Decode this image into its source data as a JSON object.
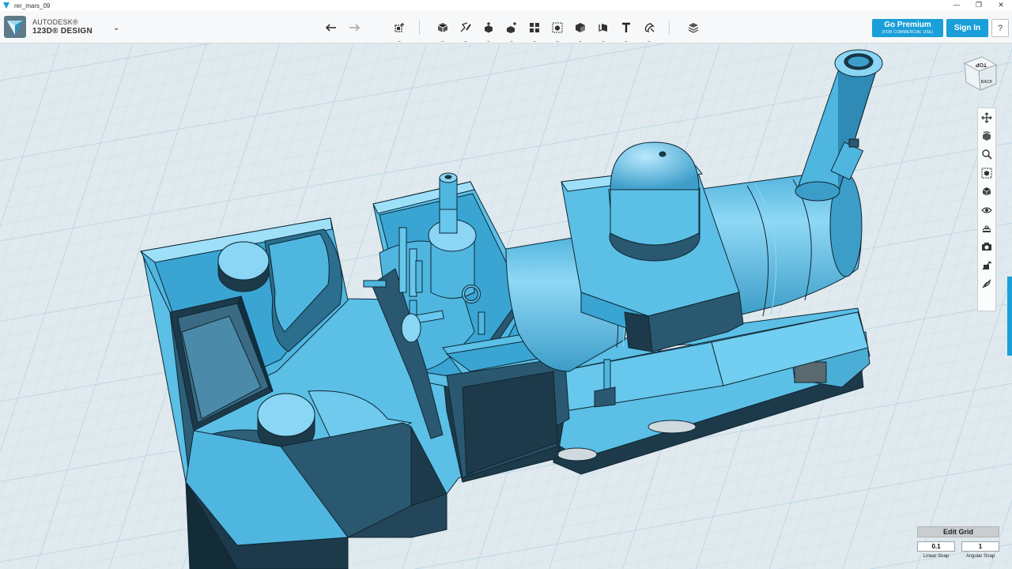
{
  "window": {
    "title": "rer_mars_09",
    "controls": {
      "minimize": "—",
      "maximize": "❐",
      "close": "✕"
    }
  },
  "brand": {
    "line1": "AUTODESK®",
    "line2": "123D® DESIGN",
    "menu_caret": "⌄"
  },
  "toolbar": {
    "groups": [
      {
        "name": "history",
        "items": [
          "undo-icon",
          "redo-icon"
        ]
      },
      {
        "name": "transform",
        "items": [
          "transform-icon"
        ]
      },
      {
        "name": "modeling",
        "items": [
          "primitives-icon",
          "sketch-icon",
          "construct-icon",
          "modify-icon",
          "pattern-icon",
          "grouping-icon",
          "combine-icon",
          "measure-icon",
          "text-icon",
          "snap-icon"
        ]
      },
      {
        "name": "material",
        "items": [
          "material-icon"
        ]
      }
    ],
    "premium_label": "Go Premium",
    "premium_sub": "(FOR COMMERCIAL USE)",
    "signin_label": "Sign In",
    "help_label": "?"
  },
  "viewcube": {
    "top_label": "TOP",
    "back_label": "BACK"
  },
  "navbar": {
    "items": [
      "pan-icon",
      "orbit-icon",
      "zoom-icon",
      "fit-icon",
      "views-icon",
      "visibility-icon",
      "materials-outline-icon",
      "screenshot-icon",
      "hide-sketches-icon",
      "hide-meshes-icon"
    ]
  },
  "editgrid": {
    "button_label": "Edit Grid",
    "linear_snap_value": "0.1",
    "angular_snap_value": "1",
    "linear_snap_label": "Linear Snap",
    "angular_snap_label": "Angular Snap"
  },
  "colors": {
    "model_fill": "#5bbfe6",
    "model_light": "#8fd8f5",
    "model_shadow": "#1d3a4a",
    "accent": "#1a9fd8",
    "grid_background": "#dfe9ee",
    "grid_lines": "#b7d5e6"
  }
}
